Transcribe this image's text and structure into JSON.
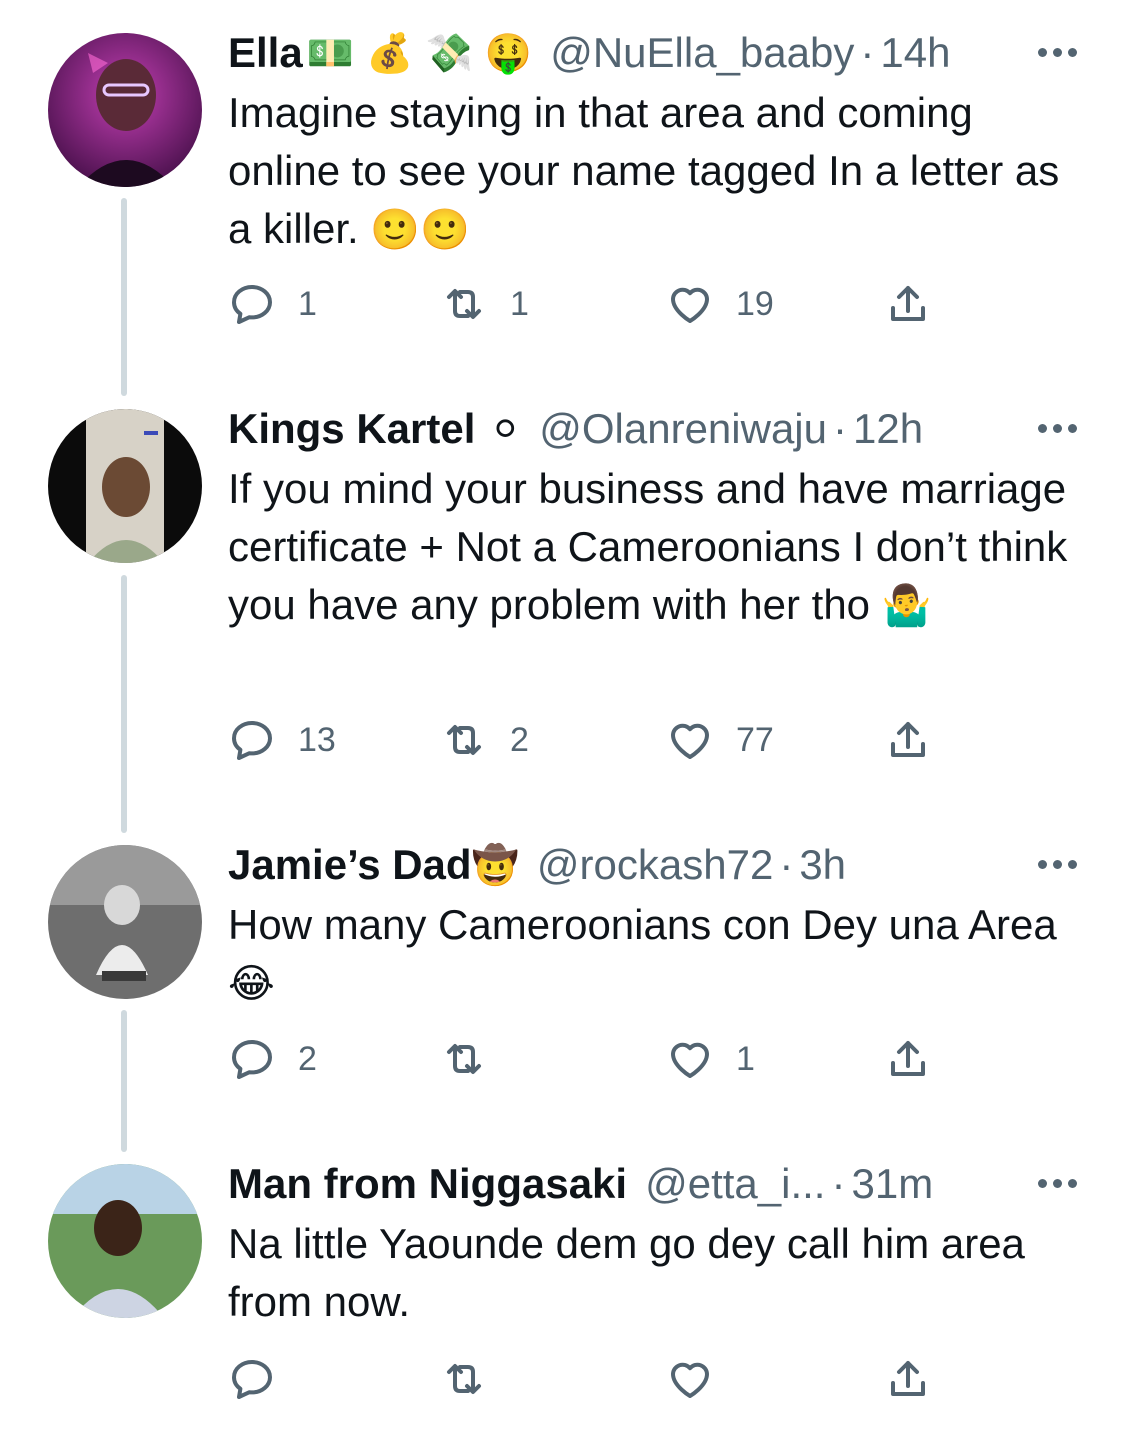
{
  "tweets": [
    {
      "name": "Ella",
      "badges": "💵 💰 💸 🤑",
      "handle": "@NuElla_baaby",
      "time": "14h",
      "text": "Imagine staying in that area and coming online to see your name tagged In a letter as a killer.",
      "text_emoji": "🙂🙂",
      "reply_count": "1",
      "retweet_count": "1",
      "like_count": "19"
    },
    {
      "name": "Kings Kartel",
      "badges": "⚪",
      "handle": "@Olanreniwaju",
      "time": "12h",
      "text": "If you mind your business and have marriage certificate + Not a Cameroonians I don’t think you have any problem with her tho",
      "text_emoji": "🤷‍♂️",
      "reply_count": "13",
      "retweet_count": "2",
      "like_count": "77"
    },
    {
      "name": "Jamie’s Dad",
      "badges": "🤠",
      "handle": "@rockash72",
      "time": "3h",
      "text": "How many Cameroonians con Dey una Area",
      "text_emoji": "😂",
      "reply_count": "2",
      "retweet_count": "",
      "like_count": "1"
    },
    {
      "name": "Man from Niggasaki",
      "badges": "",
      "handle": "@etta_i...",
      "time": "31m",
      "text": "Na little Yaounde dem go dey call him area from now.",
      "text_emoji": "",
      "reply_count": "",
      "retweet_count": "",
      "like_count": ""
    }
  ],
  "separator": "·",
  "icons": {
    "reply": "reply-icon",
    "retweet": "retweet-icon",
    "like": "heart-icon",
    "share": "share-icon",
    "more": "more-icon"
  },
  "colors": {
    "text": "#0f1419",
    "muted": "#536471",
    "thread_line": "#cfd9de"
  }
}
